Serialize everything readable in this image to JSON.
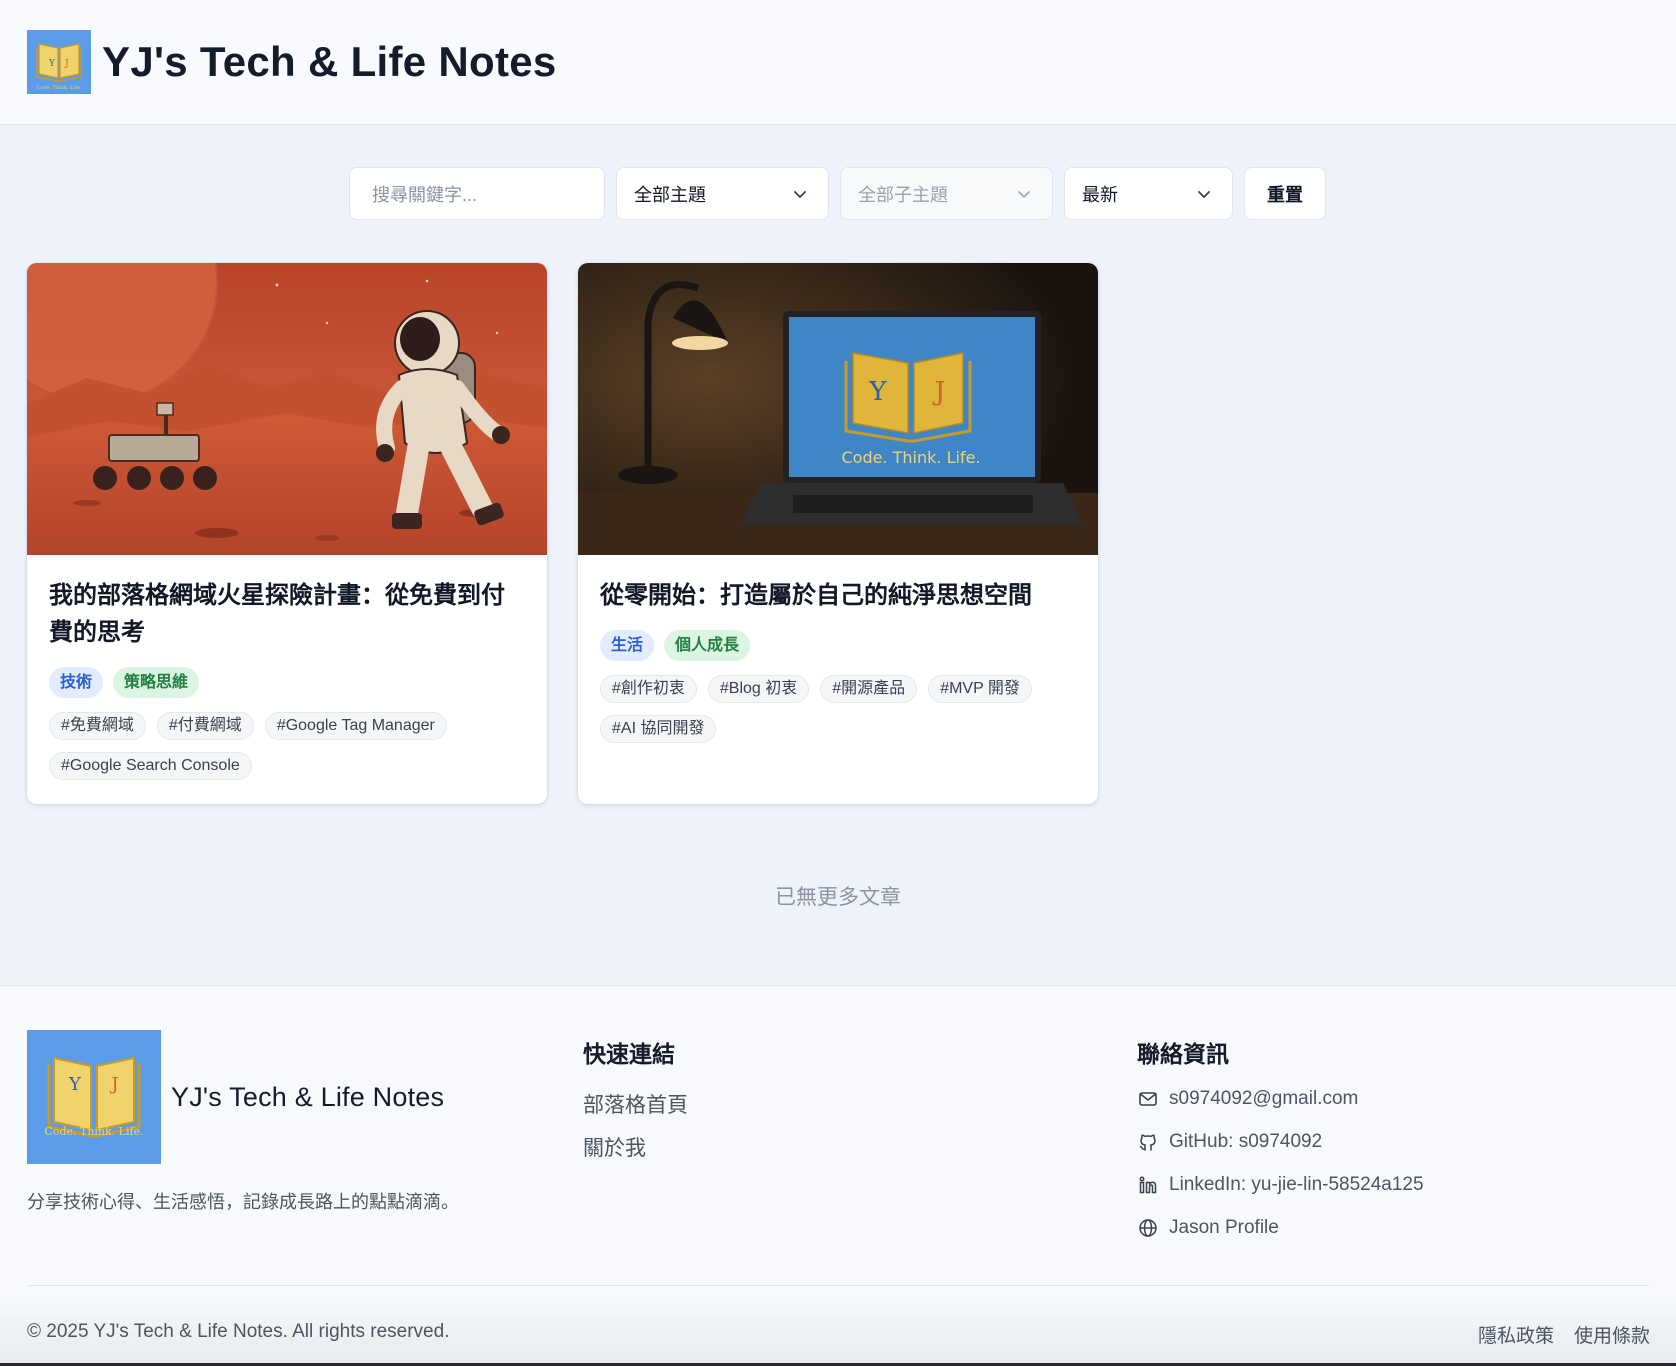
{
  "header": {
    "site_title": "YJ's Tech & Life Notes",
    "logo_letters": "Y J",
    "logo_tagline": "Code. Think. Life."
  },
  "filters": {
    "search_placeholder": "搜尋關鍵字...",
    "topic_selected": "全部主題",
    "subtopic_selected": "全部子主題",
    "sort_selected": "最新",
    "reset_label": "重置"
  },
  "posts": [
    {
      "title": "我的部落格網域火星探險計畫：從免費到付費的思考",
      "categories": [
        "技術",
        "策略思維"
      ],
      "tags": [
        "#免費網域",
        "#付費網域",
        "#Google Tag Manager",
        "#Google Search Console"
      ]
    },
    {
      "title": "從零開始：打造屬於自己的純淨思想空間",
      "categories": [
        "生活",
        "個人成長"
      ],
      "tags": [
        "#創作初衷",
        "#Blog 初衷",
        "#開源產品",
        "#MVP 開發",
        "#AI 協同開發"
      ],
      "image_letters": [
        "Y",
        "J"
      ],
      "image_tagline": "Code. Think. Life."
    }
  ],
  "end_message": "已無更多文章",
  "footer": {
    "site_name": "YJ's Tech & Life Notes",
    "logo_letters": [
      "Y",
      "J"
    ],
    "logo_tagline": "Code. Think. Life.",
    "description": "分享技術心得、生活感悟，記錄成長路上的點點滴滴。",
    "quick_links_title": "快速連結",
    "quick_links": [
      "部落格首頁",
      "關於我"
    ],
    "contact_title": "聯絡資訊",
    "contacts": [
      {
        "icon": "mail-icon",
        "text": "s0974092@gmail.com"
      },
      {
        "icon": "github-icon",
        "text": "GitHub: s0974092"
      },
      {
        "icon": "linkedin-icon",
        "text": "LinkedIn: yu-jie-lin-58524a125"
      },
      {
        "icon": "globe-icon",
        "text": "Jason Profile"
      }
    ],
    "copyright": "© 2025 YJ's Tech & Life Notes. All rights reserved.",
    "legal_links": [
      "隱私政策",
      "使用條款"
    ]
  },
  "colors": {
    "logo_blue": "#5b9ce8",
    "blue_badge_text": "#2c5fd6",
    "green_badge_text": "#23803f",
    "book_gold": "#e0b63a"
  }
}
